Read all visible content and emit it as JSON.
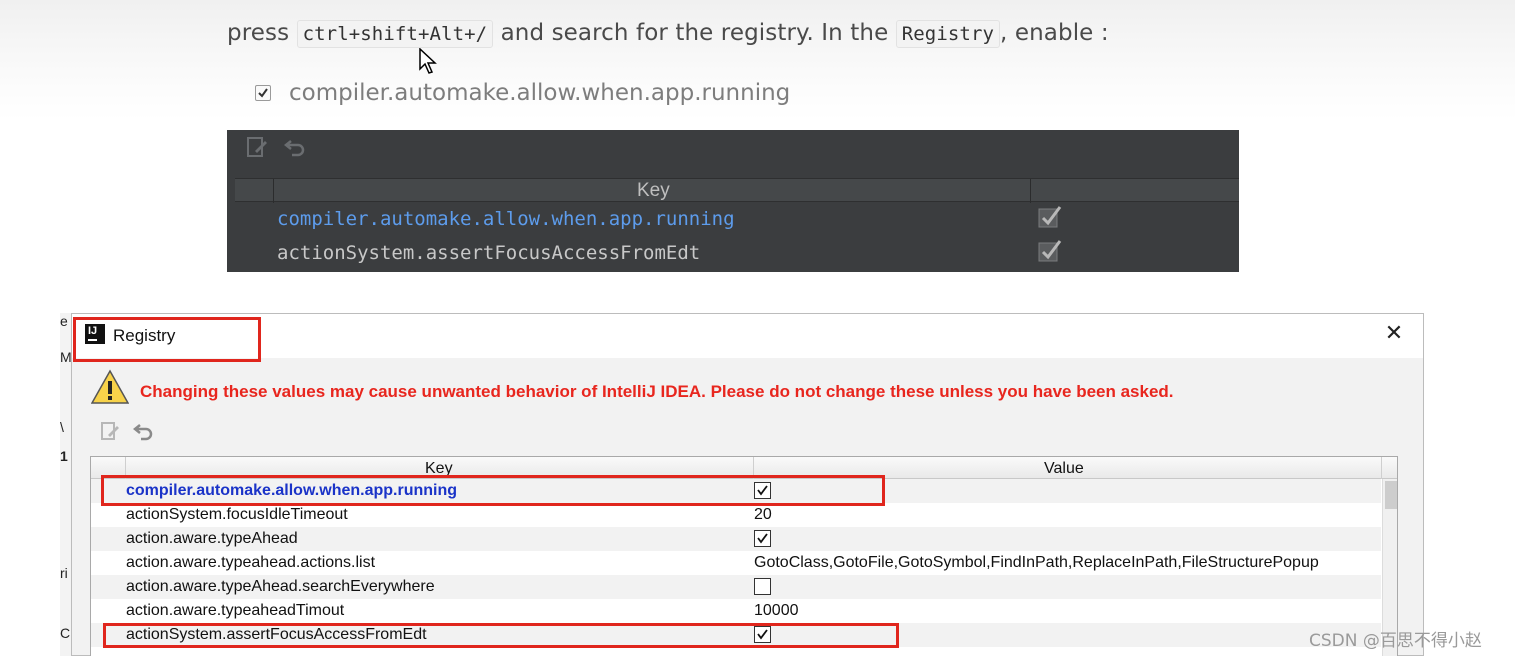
{
  "instruction": {
    "prefix": "press ",
    "shortcut": "ctrl+shift+Alt+/",
    "middle": " and search for the registry. In the ",
    "registry_code": "Registry",
    "suffix": ", enable :"
  },
  "bullet": {
    "text": "compiler.automake.allow.when.app.running",
    "checked": true
  },
  "dark_screenshot": {
    "header_key": "Key",
    "rows": [
      {
        "key": "compiler.automake.allow.when.app.running",
        "checked": true
      },
      {
        "key": "actionSystem.assertFocusAccessFromEdt",
        "checked": true
      }
    ]
  },
  "dialog": {
    "title": "Registry",
    "close_symbol": "✕",
    "warning": "Changing these values may cause unwanted behavior of IntelliJ IDEA. Please do not change these unless you have been asked.",
    "toolbar": [
      "edit-icon",
      "revert-icon"
    ],
    "table": {
      "headers": {
        "key": "Key",
        "value": "Value"
      },
      "rows": [
        {
          "key": "compiler.automake.allow.when.app.running",
          "type": "checkbox",
          "checked": true
        },
        {
          "key": "actionSystem.focusIdleTimeout",
          "type": "text",
          "value": "20"
        },
        {
          "key": "action.aware.typeAhead",
          "type": "checkbox",
          "checked": true
        },
        {
          "key": "action.aware.typeahead.actions.list",
          "type": "text",
          "value": "GotoClass,GotoFile,GotoSymbol,FindInPath,ReplaceInPath,FileStructurePopup"
        },
        {
          "key": "action.aware.typeAhead.searchEverywhere",
          "type": "checkbox",
          "checked": false
        },
        {
          "key": "action.aware.typeaheadTimout",
          "type": "text",
          "value": "10000"
        },
        {
          "key": "actionSystem.assertFocusAccessFromEdt",
          "type": "checkbox",
          "checked": true
        }
      ]
    }
  },
  "left_edge_chars": [
    "e",
    "M",
    "\\",
    "1",
    "ri",
    "C"
  ],
  "colors": {
    "highlight": "#e0261d",
    "warning_text": "#e8261e",
    "selected_key": "#1a33c8",
    "dark_panel": "#3b3d3f"
  },
  "watermark": "CSDN @百思不得小赵"
}
